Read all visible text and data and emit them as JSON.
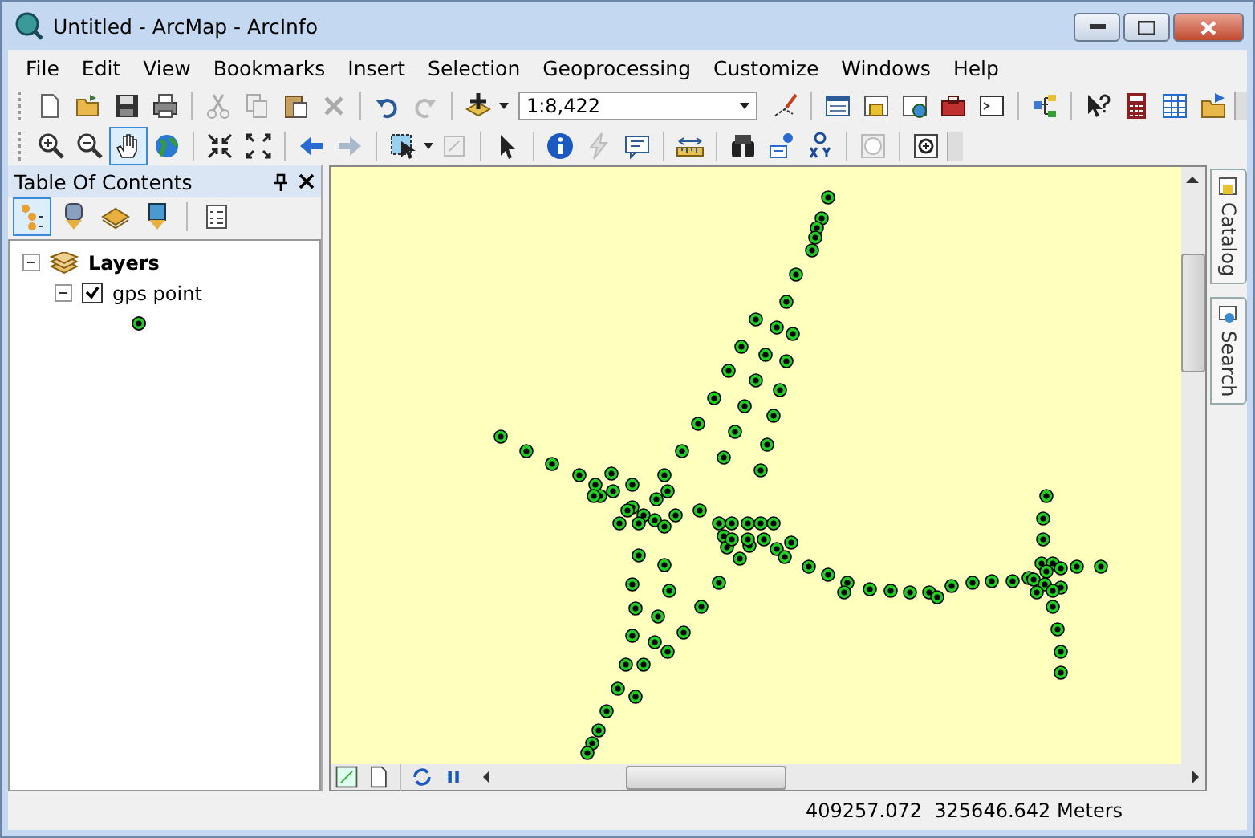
{
  "window": {
    "title": "Untitled - ArcMap - ArcInfo"
  },
  "menu": [
    "File",
    "Edit",
    "View",
    "Bookmarks",
    "Insert",
    "Selection",
    "Geoprocessing",
    "Customize",
    "Windows",
    "Help"
  ],
  "scale_field": {
    "value": "1:8,422"
  },
  "pan_tool": {
    "selected": true
  },
  "toc": {
    "title": "Table Of Contents",
    "view_buttons": [
      {
        "selected": true
      },
      {
        "selected": false
      },
      {
        "selected": false
      },
      {
        "selected": false
      },
      {
        "selected": false
      }
    ],
    "tree": [
      {
        "label": "Layers",
        "expanded": true,
        "children": [
          {
            "label": "gps point",
            "expanded": true,
            "checked": true
          }
        ]
      }
    ]
  },
  "dock_tabs": [
    "Catalog",
    "Search"
  ],
  "status_bar": {
    "coordinates": "409257.072  325646.642 Meters"
  }
}
